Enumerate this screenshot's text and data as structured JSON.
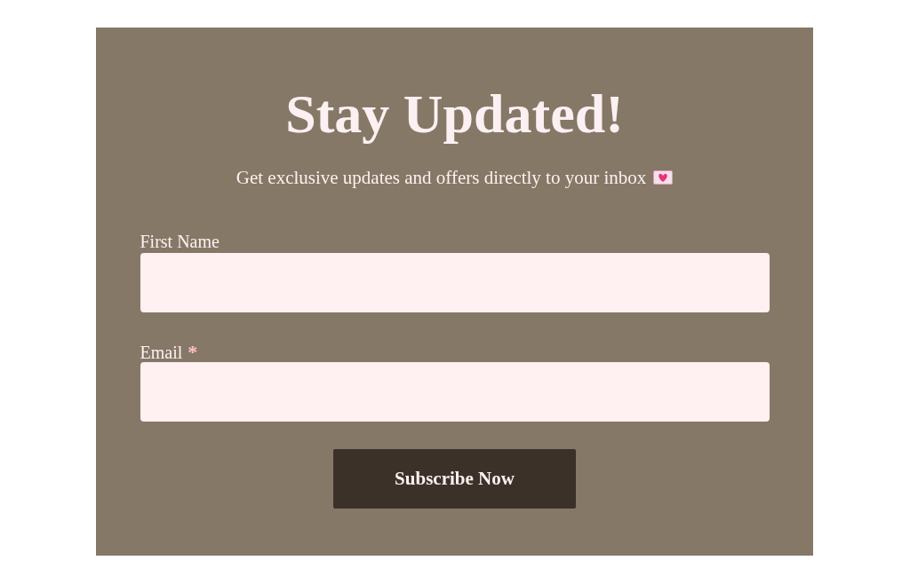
{
  "form": {
    "title": "Stay Updated!",
    "subtitle": "Get exclusive updates and offers directly to your inbox",
    "fields": [
      {
        "label": "First Name"
      },
      {
        "label": "Email",
        "required_mark": "*"
      }
    ],
    "button": "Subscribe Now"
  }
}
